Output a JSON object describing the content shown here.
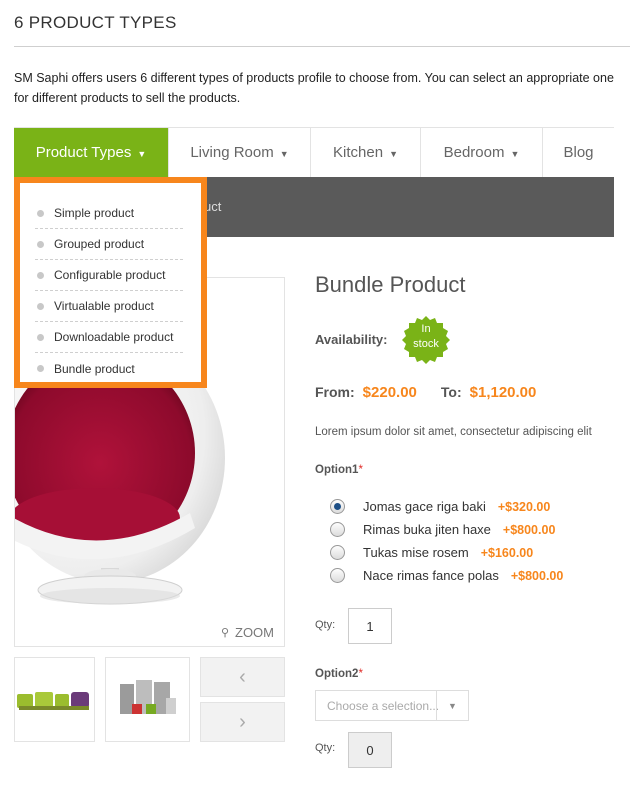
{
  "section": {
    "title": "6 PRODUCT TYPES",
    "intro": "SM Saphi offers users 6 different types of products profile to choose from. You can select an appropriate one for different products to sell the products."
  },
  "nav": {
    "items": [
      {
        "label": "Product Types",
        "chevron": "⌄"
      },
      {
        "label": "Living Room",
        "chevron": "⌄"
      },
      {
        "label": "Kitchen",
        "chevron": "⌄"
      },
      {
        "label": "Bedroom",
        "chevron": "⌄"
      },
      {
        "label": "Blog",
        "chevron": ""
      }
    ],
    "active_color": "#7ab317"
  },
  "breadcrumb_fragment": "uct",
  "dropdown": {
    "items": [
      "Simple product",
      "Grouped product",
      "Configurable product",
      "Virtualable product",
      "Downloadable product",
      "Bundle product"
    ],
    "border_color": "#f7861c"
  },
  "gallery": {
    "zoom_label": "ZOOM",
    "prev_icon": "‹",
    "next_icon": "›"
  },
  "product": {
    "name": "Bundle Product",
    "availability_label": "Availability:",
    "stock_line1": "In",
    "stock_line2": "stock",
    "from_label": "From:",
    "from_price": "$220.00",
    "to_label": "To:",
    "to_price": "$1,120.00",
    "description": "Lorem ipsum dolor sit amet, consectetur adipiscing elit"
  },
  "option1": {
    "label": "Option1",
    "required": "*",
    "choices": [
      {
        "name": "Jomas gace riga baki",
        "price": "+$320.00",
        "checked": true
      },
      {
        "name": "Rimas buka jiten haxe",
        "price": "+$800.00",
        "checked": false
      },
      {
        "name": "Tukas mise rosem",
        "price": "+$160.00",
        "checked": false
      },
      {
        "name": "Nace rimas fance polas",
        "price": "+$800.00",
        "checked": false
      }
    ],
    "qty_label": "Qty:",
    "qty": "1"
  },
  "option2": {
    "label": "Option2",
    "required": "*",
    "select_placeholder": "Choose a selection...",
    "qty_label": "Qty:",
    "qty": "0"
  },
  "colors": {
    "accent_green": "#7ab317",
    "accent_orange": "#f7861c",
    "dark_bar": "#5a5a5a"
  }
}
